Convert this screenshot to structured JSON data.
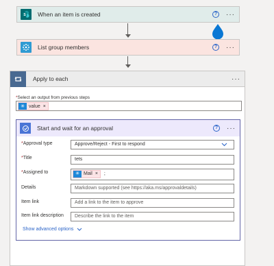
{
  "trigger": {
    "title": "When an item is created",
    "help_icon": "help-circle-icon",
    "more": "···"
  },
  "list_members": {
    "title": "List group members",
    "help_icon": "help-circle-icon",
    "more": "···"
  },
  "apply_each": {
    "title": "Apply to each",
    "more": "···",
    "select_label_req": "*",
    "select_label": "Select an output from previous steps",
    "token_label": "value",
    "token_close": "×"
  },
  "approval": {
    "title": "Start and wait for an approval",
    "more": "···",
    "fields": {
      "approval_type": {
        "req": "*",
        "label": "Approval type",
        "value": "Approve/Reject - First to respond"
      },
      "title": {
        "req": "*",
        "label": "Title",
        "value": "tets"
      },
      "assigned_to": {
        "req": "*",
        "label": "Assigned to",
        "token": "Mail",
        "token_close": "×",
        "suffix": ";"
      },
      "details": {
        "label": "Details",
        "placeholder": "Markdown supported (see https://aka.ms/approvaldetails)"
      },
      "item_link": {
        "label": "Item link",
        "placeholder": "Add a link to the item to approve"
      },
      "item_link_desc": {
        "label": "Item link description",
        "placeholder": "Describe the link to the item"
      }
    },
    "advanced": "Show advanced options"
  },
  "colors": {
    "trigger_bg": "#e0ecea",
    "sharepoint": "#036c70",
    "list_bg": "#fbe4e0",
    "list_icon": "#2f9bd3",
    "apply_bg": "#ececec",
    "apply_icon": "#486991",
    "approval_bg": "#ede9fc",
    "approval_border": "#6264a7",
    "approval_icon": "#4a74d6",
    "drop": "#0a78d4"
  }
}
